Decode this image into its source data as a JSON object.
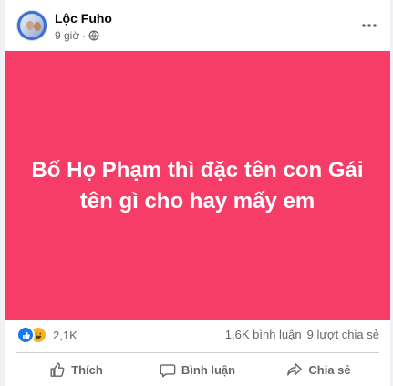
{
  "post": {
    "author": "Lộc Fuho",
    "time": "9 giờ",
    "separator": "·",
    "banner_lines": [
      "Bố Họ Phạm thì đặc tên con Gái",
      "tên gì cho hay mấy em"
    ],
    "banner_color": "#f53d68"
  },
  "stats": {
    "reaction_icons": [
      "like-icon",
      "haha-icon"
    ],
    "reaction_count": "2,1K",
    "comments": "1,6K bình luận",
    "shares": "9 lượt chia sẻ"
  },
  "actions": {
    "like_label": "Thích",
    "comment_label": "Bình luận",
    "share_label": "Chia sẻ"
  }
}
